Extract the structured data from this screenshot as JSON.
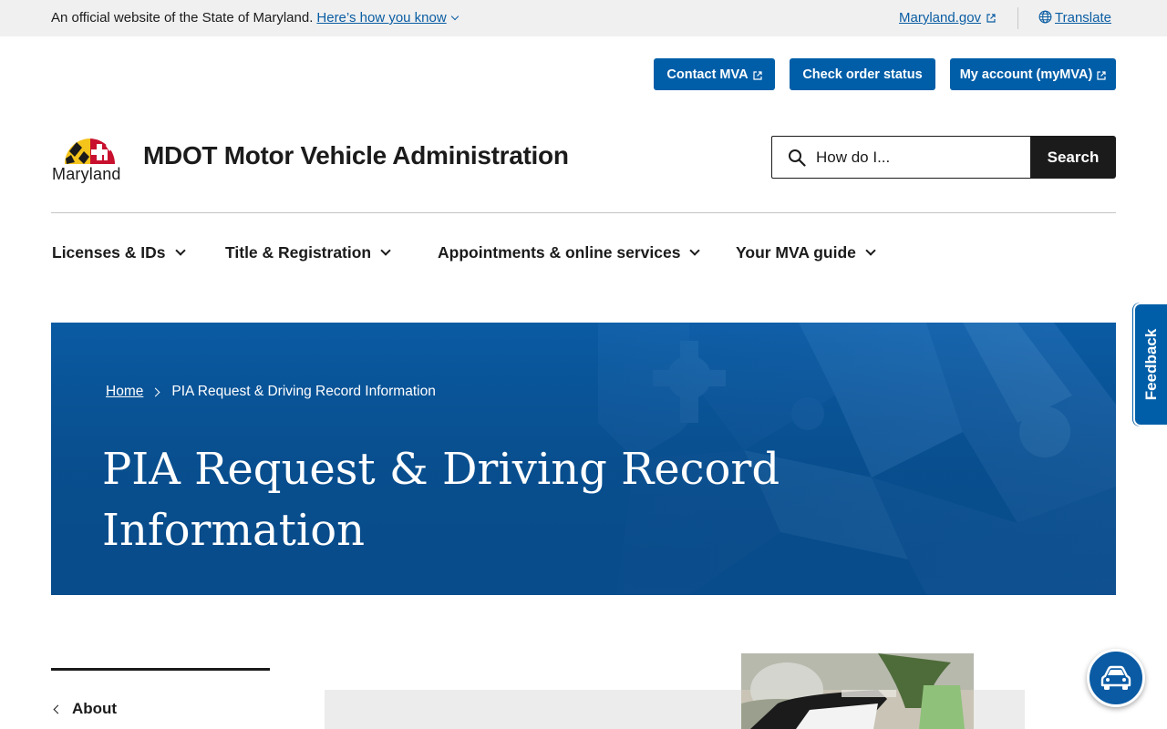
{
  "gov_banner": {
    "official_text": "An official website of the State of Maryland.",
    "how_you_know": "Here’s how you know",
    "maryland_gov": "Maryland.gov",
    "translate": "Translate"
  },
  "utility_nav": {
    "contact": "Contact MVA",
    "order_status": "Check order status",
    "account": "My account (myMVA)"
  },
  "header": {
    "logo_text": "Maryland",
    "site_title": "MDOT Motor Vehicle Administration",
    "search_placeholder": "How do I...",
    "search_button": "Search"
  },
  "main_nav": [
    {
      "label": "Licenses & IDs"
    },
    {
      "label": "Title & Registration"
    },
    {
      "label": "Appointments & online services"
    },
    {
      "label": "Your MVA guide"
    }
  ],
  "breadcrumb": {
    "home": "Home",
    "current": "PIA Request & Driving Record Information"
  },
  "hero": {
    "title": "PIA Request & Driving Record Information"
  },
  "feedback": {
    "label": "Feedback"
  },
  "side_nav": {
    "about": "About"
  },
  "colors": {
    "primary_blue": "#005ea8",
    "hero_blue": "#0a5ba4",
    "dark": "#1b1b1b",
    "banner_bg": "#f0f0f0"
  },
  "icons": [
    "chevron-down-icon",
    "external-link-icon",
    "globe-icon",
    "search-icon",
    "chevron-right-icon",
    "chevron-left-icon",
    "car-chat-icon"
  ]
}
